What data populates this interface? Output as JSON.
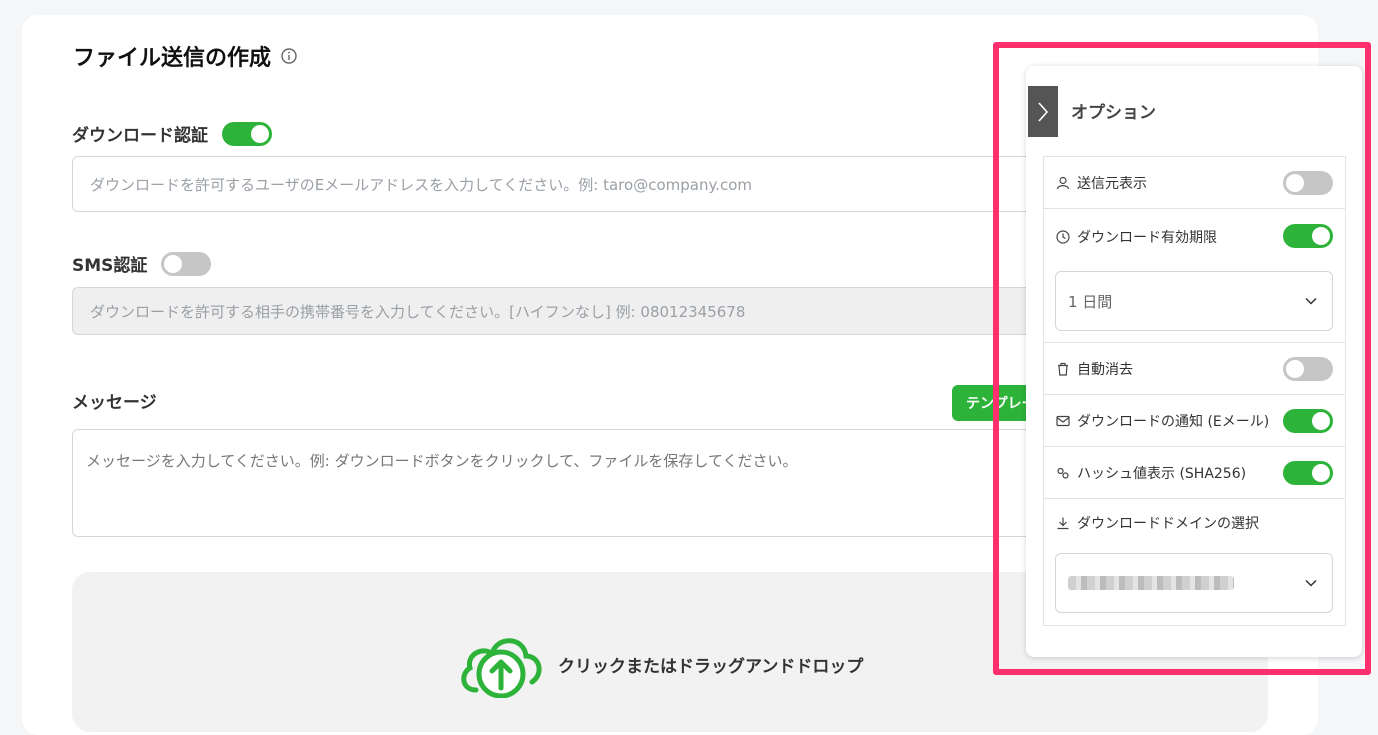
{
  "page": {
    "title": "ファイル送信の作成"
  },
  "download_auth": {
    "label": "ダウンロード認証",
    "enabled": true,
    "placeholder": "ダウンロードを許可するユーザのEメールアドレスを入力してください。例: taro@company.com"
  },
  "sms_auth": {
    "label": "SMS認証",
    "enabled": false,
    "placeholder": "ダウンロードを許可する相手の携帯番号を入力してください。[ハイフンなし] 例: 08012345678"
  },
  "message": {
    "label": "メッセージ",
    "template_button": "テンプレート",
    "placeholder": "メッセージを入力してください。例: ダウンロードボタンをクリックして、ファイルを保存してください。"
  },
  "dropzone": {
    "label": "クリックまたはドラッグアンドドロップ"
  },
  "options_panel": {
    "title": "オプション",
    "items": [
      {
        "label": "送信元表示",
        "icon": "user-icon",
        "enabled": false
      },
      {
        "label": "ダウンロード有効期限",
        "icon": "clock-icon",
        "enabled": true
      },
      {
        "label": "自動消去",
        "icon": "trash-icon",
        "enabled": false
      },
      {
        "label": "ダウンロードの通知 (Eメール)",
        "icon": "mail-icon",
        "enabled": true
      },
      {
        "label": "ハッシュ値表示 (SHA256)",
        "icon": "gears-icon",
        "enabled": true
      },
      {
        "label": "ダウンロードドメインの選択",
        "icon": "download-icon"
      }
    ],
    "expiry_select": {
      "value": "1 日間"
    },
    "domain_select": {
      "value_blurred": true
    }
  },
  "colors": {
    "accent_green": "#2db33a",
    "highlight": "#ff2f6e",
    "toggle_off": "#c6c6c6"
  }
}
